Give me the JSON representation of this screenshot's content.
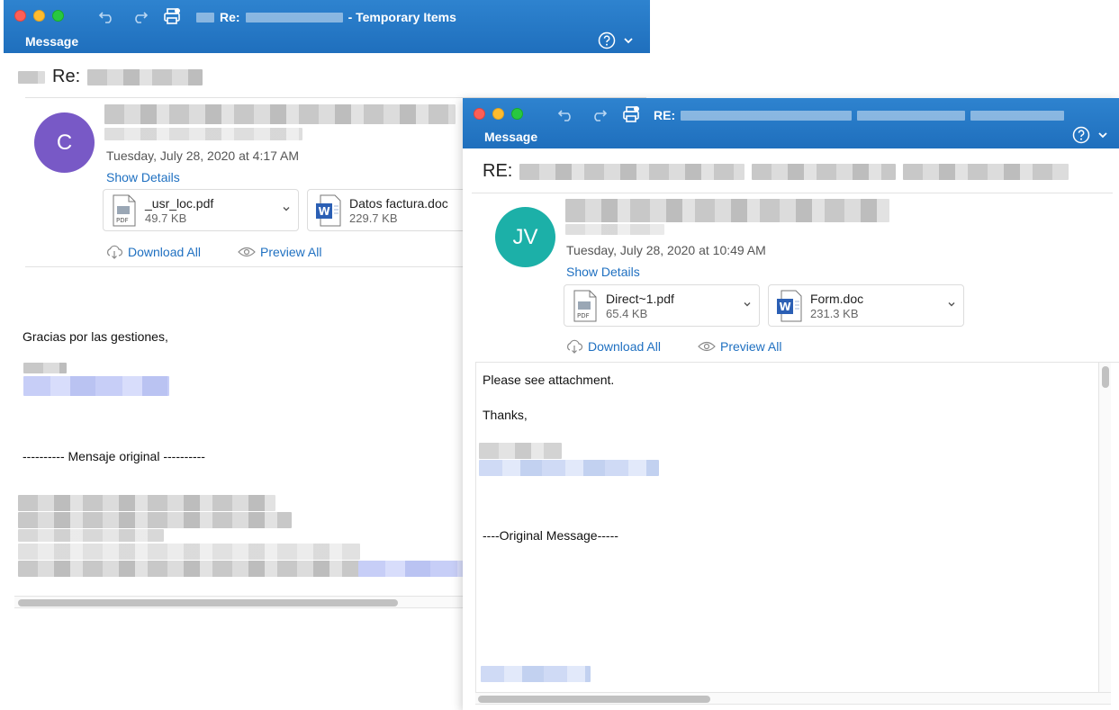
{
  "windows": [
    {
      "title_prefix": "Re:",
      "title_suffix": "- Temporary Items",
      "tab_label": "Message",
      "subject_prefix": "Re:",
      "avatar_initials": "C",
      "avatar_color": "#7859c6",
      "date": "Tuesday, July 28, 2020 at 4:17 AM",
      "show_details": "Show Details",
      "attachments": [
        {
          "name": "_usr_loc.pdf",
          "size": "49.7 KB",
          "icon": "pdf-file-icon"
        },
        {
          "name": "Datos factura.doc",
          "size": "229.7 KB",
          "icon": "word-file-icon"
        }
      ],
      "download_all": "Download All",
      "preview_all": "Preview All",
      "body": {
        "greeting": "Gracias por las gestiones,",
        "separator": "---------- Mensaje original ----------"
      }
    },
    {
      "title_prefix": "RE:",
      "tab_label": "Message",
      "subject_prefix": "RE:",
      "avatar_initials": "JV",
      "avatar_color": "#1cb0a8",
      "date": "Tuesday, July 28, 2020 at 10:49 AM",
      "show_details": "Show Details",
      "attachments": [
        {
          "name": "Direct~1.pdf",
          "size": "65.4 KB",
          "icon": "pdf-file-icon"
        },
        {
          "name": "Form.doc",
          "size": "231.3 KB",
          "icon": "word-file-icon"
        }
      ],
      "download_all": "Download All",
      "preview_all": "Preview All",
      "body": {
        "line1": "Please see attachment.",
        "line2": "Thanks,",
        "separator": "----Original Message-----"
      }
    }
  ],
  "colors": {
    "titlebar": "#1f6fbd",
    "link": "#1f70c1"
  }
}
